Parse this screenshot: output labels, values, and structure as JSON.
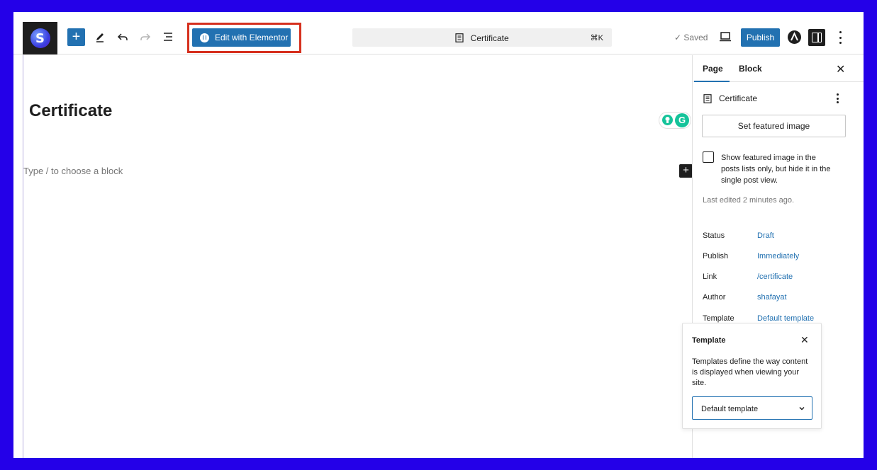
{
  "colors": {
    "background_frame": "#2400e8",
    "primary": "#2271b1",
    "highlight_border": "#d6301e",
    "dark": "#1e1e1e",
    "muted": "#757575",
    "grammarly": "#15c39a"
  },
  "toolbar": {
    "logo_letter": "S",
    "add_label": "+",
    "edit_elementor_label": "Edit with Elementor",
    "icons": [
      "plus-icon",
      "pencil-icon",
      "undo-icon",
      "redo-icon",
      "list-view-icon",
      "document-icon",
      "desktop-preview-icon",
      "astra-icon",
      "settings-sidebar-icon",
      "more-vertical-icon"
    ],
    "command_bar": {
      "title": "Certificate",
      "shortcut": "⌘K"
    },
    "saved_label": "✓ Saved",
    "publish_label": "Publish"
  },
  "editor": {
    "page_title": "Certificate",
    "block_placeholder": "Type / to choose a block",
    "grammarly_letter": "G",
    "inline_add_label": "+"
  },
  "sidebar": {
    "tabs": [
      {
        "label": "Page",
        "active": true
      },
      {
        "label": "Block",
        "active": false
      }
    ],
    "close_label": "✕",
    "document_title": "Certificate",
    "featured_image_button": "Set featured image",
    "featured_checkbox_label": "Show featured image in the posts lists only, but hide it in the single post view.",
    "last_edited": "Last edited 2 minutes ago.",
    "meta": [
      {
        "key": "Status",
        "value": "Draft"
      },
      {
        "key": "Publish",
        "value": "Immediately"
      },
      {
        "key": "Link",
        "value": "/certificate"
      },
      {
        "key": "Author",
        "value": "shafayat"
      },
      {
        "key": "Template",
        "value": "Default template"
      }
    ]
  },
  "template_popover": {
    "title": "Template",
    "close_label": "✕",
    "description": "Templates define the way content is displayed when viewing your site.",
    "selected_value": "Default template"
  }
}
